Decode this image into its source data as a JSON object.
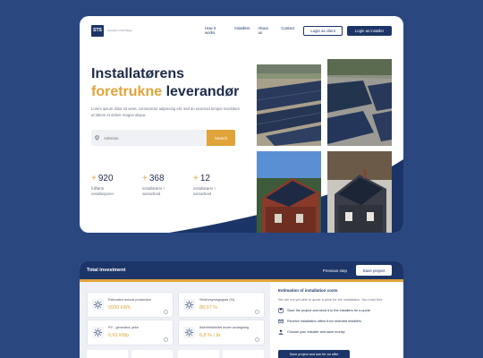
{
  "colors": {
    "background": "#2a4780",
    "primary": "#1c3568",
    "accent": "#e0a43a"
  },
  "nav": {
    "logo": "STS",
    "logo_tagline": "Solceller til Din Bolig",
    "links": [
      {
        "label": "How it works"
      },
      {
        "label": "Installers"
      },
      {
        "label": "About us"
      },
      {
        "label": "Contact"
      }
    ],
    "client_login": "Login as client",
    "installer_login": "Login as installer"
  },
  "hero": {
    "title_part1": "Installatørens",
    "title_accent": "foretrukne",
    "title_part2": "leverandør",
    "description": "Lorem ipsum dolor sit amet, consectetur adipiscing elit, sed do eiusmod tempor incididunt ut labore et dolore magna aliqua.",
    "search_placeholder": "Adresse",
    "search_button": "Search"
  },
  "stats": [
    {
      "plus": "+",
      "value": "920",
      "label": "fullførte installasjoner"
    },
    {
      "plus": "+",
      "value": "368",
      "label": "installatører i samarbeid"
    },
    {
      "plus": "+",
      "value": "12",
      "label": "installatører i samarbeid"
    }
  ],
  "photos": [
    {
      "icon": "solar-field-photo"
    },
    {
      "icon": "solar-roof-closeup-photo"
    },
    {
      "icon": "red-house-solar-photo"
    },
    {
      "icon": "dark-house-solar-photo"
    }
  ],
  "investment": {
    "title": "Total investment",
    "previous_step": "Previous step",
    "save_project": "Save project",
    "tiles": [
      {
        "label": "Estimated annual production",
        "value": "5500 kWh",
        "icon": "sun-icon"
      },
      {
        "label": "Selvforsyningsgrad (%)",
        "value": "88,97 %",
        "icon": "sun-icon"
      },
      {
        "label": "PV - generator peke",
        "value": "6,62 kWp",
        "icon": "sun-icon"
      },
      {
        "label": "Ikke/elektrisitet under avslagning",
        "value": "6,8 % / år",
        "icon": "sun-icon"
      }
    ],
    "estimation_title": "Estimation of installation costs",
    "estimation_text": "We are not yet able to quote a price for the installation. You must first:",
    "steps": [
      {
        "label": "Save the project and send it to the installers for a quote"
      },
      {
        "label": "Receive installation offers from selected installers"
      },
      {
        "label": "Choose your installer and save money"
      }
    ],
    "offer_button": "Save project and ask for an offer"
  }
}
